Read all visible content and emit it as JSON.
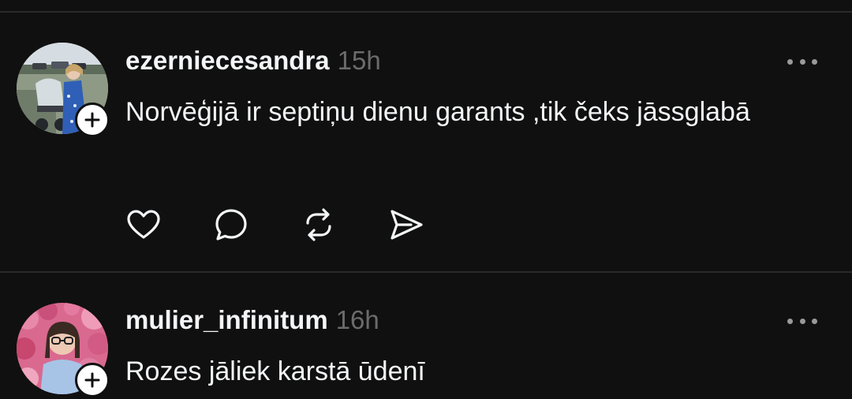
{
  "posts": [
    {
      "username": "ezerniecesandra",
      "time": "15h",
      "text": "Norvēģijā ir septiņu dienu garants ,tik čeks jāssglabā"
    },
    {
      "username": "mulier_infinitum",
      "time": "16h",
      "text": "Rozes jāliek karstā ūdenī"
    }
  ],
  "icons": {
    "like": "heart-icon",
    "reply": "comment-icon",
    "repost": "repost-icon",
    "share": "send-icon",
    "more": "more-icon",
    "follow": "plus-icon"
  },
  "colors": {
    "background": "#101010",
    "text": "#f3f5f7",
    "muted": "#6b6b6b",
    "divider": "#2a2a2a"
  }
}
